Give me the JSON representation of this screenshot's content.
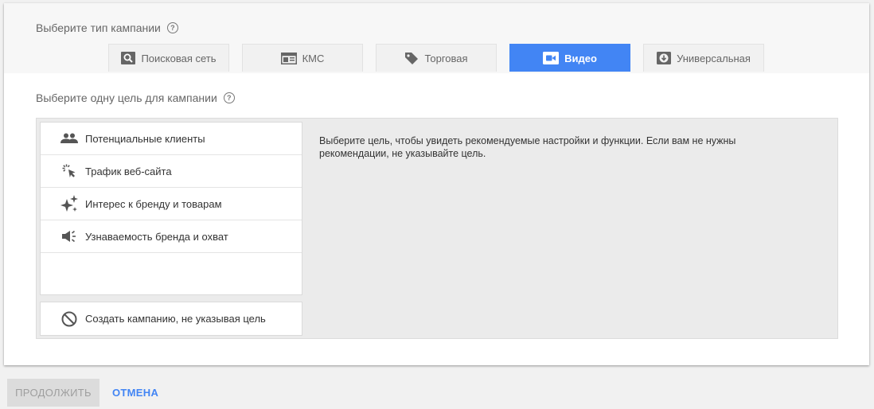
{
  "campaign_type": {
    "label": "Выберите тип кампании",
    "help_glyph": "?",
    "tabs": [
      {
        "label": "Поисковая сеть",
        "icon": "search-icon",
        "active": false
      },
      {
        "label": "КМС",
        "icon": "display-network-icon",
        "active": false
      },
      {
        "label": "Торговая",
        "icon": "shopping-tag-icon",
        "active": false
      },
      {
        "label": "Видео",
        "icon": "video-camera-icon",
        "active": true
      },
      {
        "label": "Универсальная",
        "icon": "app-download-icon",
        "active": false
      }
    ]
  },
  "goal": {
    "label": "Выберите одну цель для кампании",
    "help_glyph": "?",
    "items": [
      {
        "label": "Потенциальные клиенты",
        "icon": "people-icon"
      },
      {
        "label": "Трафик веб-сайта",
        "icon": "click-cursor-icon"
      },
      {
        "label": "Интерес к бренду и товарам",
        "icon": "sparkle-icon"
      },
      {
        "label": "Узнаваемость бренда и охват",
        "icon": "megaphone-icon"
      }
    ],
    "no_goal": {
      "label": "Создать кампанию, не указывая цель",
      "icon": "block-icon"
    },
    "hint": "Выберите цель, чтобы увидеть рекомендуемые настройки и функции. Если вам не нужны рекомендации, не указывайте цель."
  },
  "footer": {
    "continue_label": "ПРОДОЛЖИТЬ",
    "cancel_label": "ОТМЕНА"
  },
  "colors": {
    "accent": "#4285f4",
    "panel_bg": "#ebebeb",
    "disabled_btn": "#dcdcdc"
  }
}
